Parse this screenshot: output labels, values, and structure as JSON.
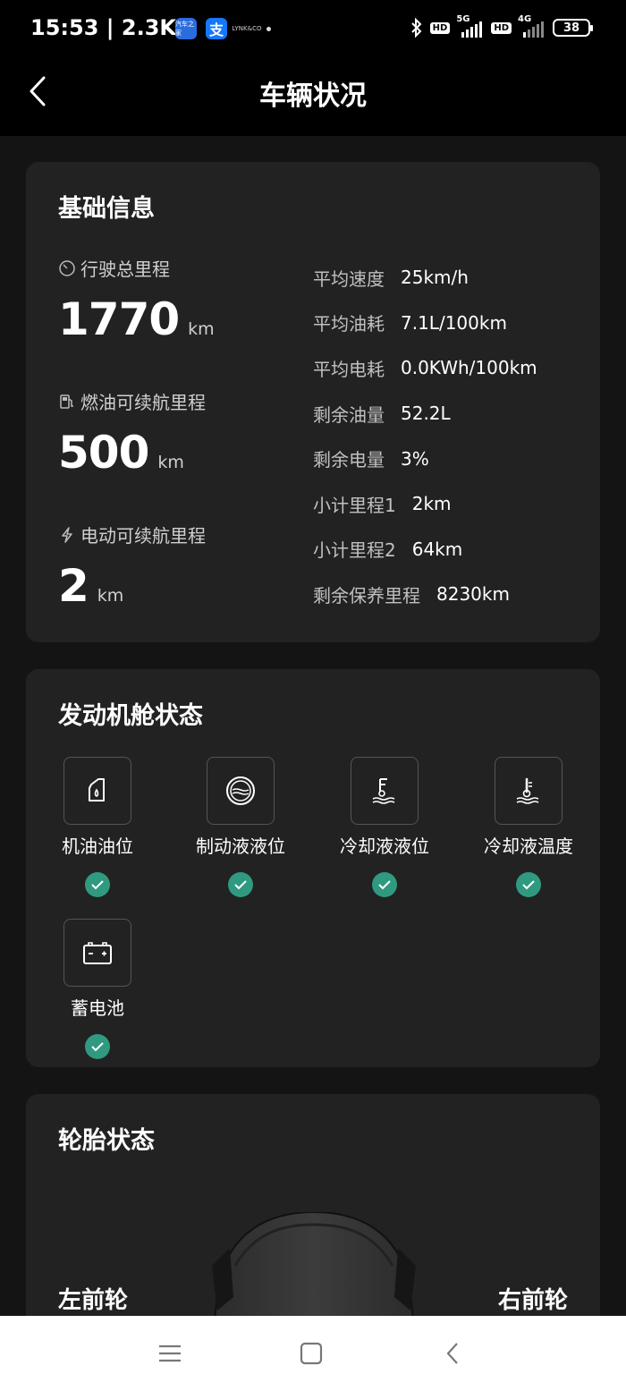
{
  "status_bar": {
    "time": "15:53 | 2.3K/s",
    "apps": [
      "autohome-app-icon",
      "alipay-app-icon",
      "lynk-app-icon"
    ],
    "alipay_glyph": "支",
    "autohome_text": "汽车之家",
    "lynk_text": "LYNK&CO",
    "sim1_gen": "5G",
    "sim2_gen": "4G",
    "hd1": "HD",
    "hd2": "HD",
    "battery": "38"
  },
  "header": {
    "title": "车辆状况"
  },
  "basic": {
    "title": "基础信息",
    "total_mileage": {
      "label": "行驶总里程",
      "value": "1770",
      "unit": "km"
    },
    "fuel_range": {
      "label": "燃油可续航里程",
      "value": "500",
      "unit": "km"
    },
    "electric_range": {
      "label": "电动可续航里程",
      "value": "2",
      "unit": "km"
    },
    "details": [
      {
        "key": "平均速度",
        "value": "25km/h"
      },
      {
        "key": "平均油耗",
        "value": "7.1L/100km"
      },
      {
        "key": "平均电耗",
        "value": "0.0KWh/100km"
      },
      {
        "key": "剩余油量",
        "value": "52.2L"
      },
      {
        "key": "剩余电量",
        "value": "3%"
      },
      {
        "key": "小计里程1",
        "value": "2km"
      },
      {
        "key": "小计里程2",
        "value": "64km"
      },
      {
        "key": "剩余保养里程",
        "value": "8230km"
      }
    ]
  },
  "engine": {
    "title": "发动机舱状态",
    "items": [
      {
        "label": "机油油位",
        "icon": "oil-level-icon",
        "status": "ok"
      },
      {
        "label": "制动液液位",
        "icon": "brake-fluid-icon",
        "status": "ok"
      },
      {
        "label": "冷却液液位",
        "icon": "coolant-level-icon",
        "status": "ok"
      },
      {
        "label": "冷却液温度",
        "icon": "coolant-temp-icon",
        "status": "ok"
      },
      {
        "label": "蓄电池",
        "icon": "battery-icon",
        "status": "ok"
      }
    ]
  },
  "tire": {
    "title": "轮胎状态",
    "front_left": "左前轮",
    "front_right": "右前轮"
  },
  "colors": {
    "background": "#141414",
    "card": "#222222",
    "ok_green": "#2f9a80",
    "header": "#000000"
  },
  "nav": {
    "buttons": [
      "menu-icon",
      "home-icon",
      "back-icon"
    ]
  }
}
